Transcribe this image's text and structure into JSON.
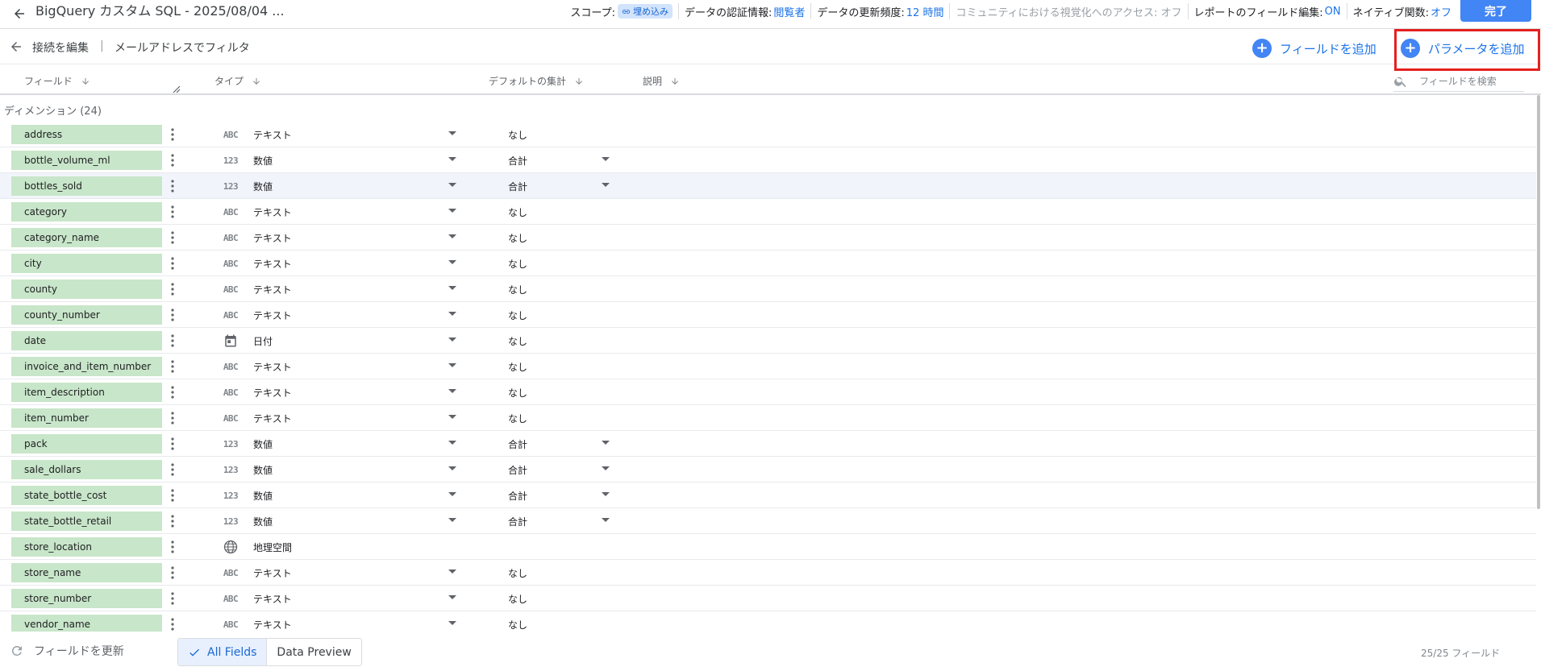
{
  "topbar": {
    "title": "BigQuery カスタム SQL - 2025/08/04 ...",
    "scope_label": "スコープ:",
    "scope_chip": "埋め込み",
    "cred_label": "データの認証情報:",
    "cred_value": "閲覧者",
    "freshness_label": "データの更新頻度:",
    "freshness_value": "12 時間",
    "community_text": "コミュニティにおける視覚化へのアクセス: オフ",
    "report_edit_label": "レポートのフィールド編集:",
    "report_edit_value": "ON",
    "native_label": "ネイティブ関数:",
    "native_value": "オフ",
    "done_label": "完了"
  },
  "subbar": {
    "edit_connection": "接続を編集",
    "separator": "|",
    "filter_by_email": "メールアドレスでフィルタ",
    "add_field": "フィールドを追加",
    "add_parameter": "パラメータを追加"
  },
  "columns": {
    "field": "フィールド",
    "type": "タイプ",
    "default_agg": "デフォルトの集計",
    "description": "説明",
    "search_placeholder": "フィールドを検索"
  },
  "group_label": "ディメンション (24)",
  "rows": [
    {
      "name": "address",
      "type_icon": "ABC",
      "type": "テキスト",
      "agg": "なし",
      "agg_drop": false
    },
    {
      "name": "bottle_volume_ml",
      "type_icon": "123",
      "type": "数値",
      "agg": "合計",
      "agg_drop": true
    },
    {
      "name": "bottles_sold",
      "type_icon": "123",
      "type": "数値",
      "agg": "合計",
      "agg_drop": true
    },
    {
      "name": "category",
      "type_icon": "ABC",
      "type": "テキスト",
      "agg": "なし",
      "agg_drop": false
    },
    {
      "name": "category_name",
      "type_icon": "ABC",
      "type": "テキスト",
      "agg": "なし",
      "agg_drop": false
    },
    {
      "name": "city",
      "type_icon": "ABC",
      "type": "テキスト",
      "agg": "なし",
      "agg_drop": false
    },
    {
      "name": "county",
      "type_icon": "ABC",
      "type": "テキスト",
      "agg": "なし",
      "agg_drop": false
    },
    {
      "name": "county_number",
      "type_icon": "ABC",
      "type": "テキスト",
      "agg": "なし",
      "agg_drop": false
    },
    {
      "name": "date",
      "type_icon": "calendar",
      "type": "日付",
      "agg": "なし",
      "agg_drop": false
    },
    {
      "name": "invoice_and_item_number",
      "type_icon": "ABC",
      "type": "テキスト",
      "agg": "なし",
      "agg_drop": false
    },
    {
      "name": "item_description",
      "type_icon": "ABC",
      "type": "テキスト",
      "agg": "なし",
      "agg_drop": false
    },
    {
      "name": "item_number",
      "type_icon": "ABC",
      "type": "テキスト",
      "agg": "なし",
      "agg_drop": false
    },
    {
      "name": "pack",
      "type_icon": "123",
      "type": "数値",
      "agg": "合計",
      "agg_drop": true
    },
    {
      "name": "sale_dollars",
      "type_icon": "123",
      "type": "数値",
      "agg": "合計",
      "agg_drop": true
    },
    {
      "name": "state_bottle_cost",
      "type_icon": "123",
      "type": "数値",
      "agg": "合計",
      "agg_drop": true
    },
    {
      "name": "state_bottle_retail",
      "type_icon": "123",
      "type": "数値",
      "agg": "合計",
      "agg_drop": true
    },
    {
      "name": "store_location",
      "type_icon": "globe",
      "type": "地理空間",
      "agg": "",
      "agg_drop": false
    },
    {
      "name": "store_name",
      "type_icon": "ABC",
      "type": "テキスト",
      "agg": "なし",
      "agg_drop": false
    },
    {
      "name": "store_number",
      "type_icon": "ABC",
      "type": "テキスト",
      "agg": "なし",
      "agg_drop": false
    },
    {
      "name": "vendor_name",
      "type_icon": "ABC",
      "type": "テキスト",
      "agg": "なし",
      "agg_drop": false
    }
  ],
  "highlighted_row": "bottles_sold",
  "footer": {
    "refresh_fields": "フィールドを更新",
    "tab_all_fields": "All Fields",
    "tab_data_preview": "Data Preview",
    "field_count": "25/25 フィールド"
  },
  "colors": {
    "accent": "#1a73e8",
    "pill_green": "#c8e6c9",
    "highlight_red": "#e52020",
    "done_button": "#4285f4"
  }
}
